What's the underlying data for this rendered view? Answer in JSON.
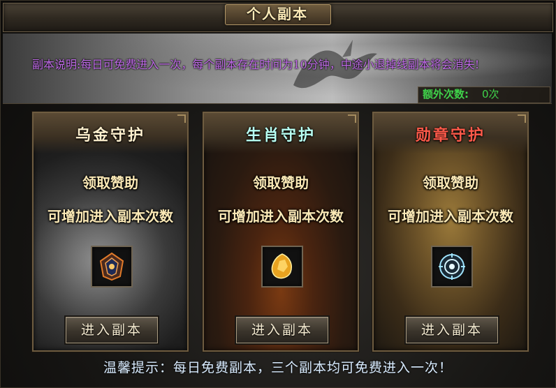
{
  "window": {
    "title": "个人副本"
  },
  "banner": {
    "notice": "副本说明:每日可免费进入一次，每个副本存在时间为10分钟，中途小退掉线副本将会消失!",
    "extra_label": "额外次数:",
    "extra_value": "0次"
  },
  "cards": [
    {
      "title": "乌金守护",
      "line1": "领取赞助",
      "line2": "可增加进入副本次数",
      "item_icon": "dark-gem-icon",
      "button": "进入副本"
    },
    {
      "title": "生肖守护",
      "line1": "领取赞助",
      "line2": "可增加进入副本次数",
      "item_icon": "gold-ore-icon",
      "button": "进入副本"
    },
    {
      "title": "勋章守护",
      "line1": "领取赞助",
      "line2": "可增加进入副本次数",
      "item_icon": "medal-emblem-icon",
      "button": "进入副本"
    }
  ],
  "footer": {
    "tip": "温馨提示：每日免费副本，三个副本均可免费进入一次！"
  },
  "colors": {
    "notice": "#c06be8",
    "extra": "#3fd24a",
    "card1_title": "#fff1cf",
    "card2_title": "#b8fff2",
    "card3_title": "#ff5a4a",
    "tip": "#d8ebff"
  }
}
